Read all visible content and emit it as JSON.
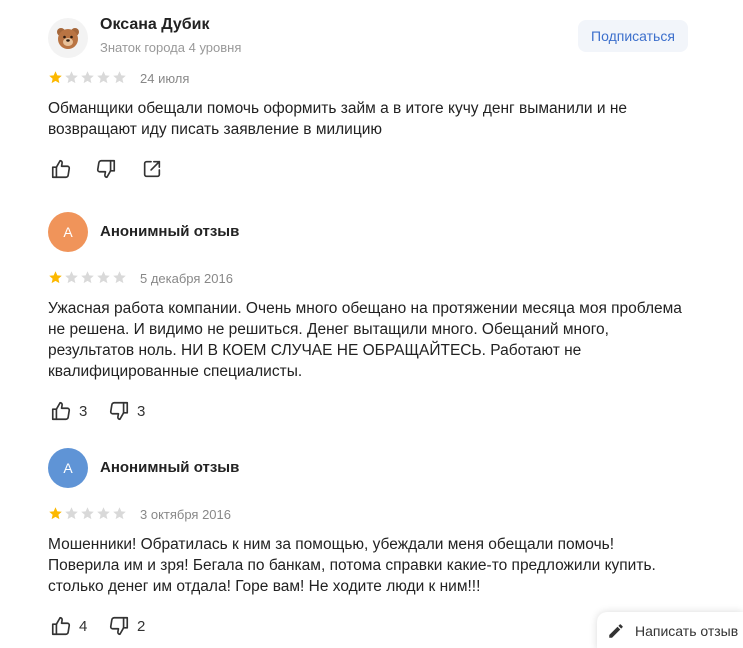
{
  "reviews": [
    {
      "author": "Оксана Дубик",
      "level": "Знаток города 4 уровня",
      "avatar_letter": "",
      "rating": 1,
      "date": "24 июля",
      "text": "Обманщики обещали помочь оформить займ а в итоге кучу денг выманили и не возвращают иду писать заявление в милицию",
      "likes": "",
      "dislikes": ""
    },
    {
      "author": "Анонимный отзыв",
      "avatar_letter": "А",
      "rating": 1,
      "date": "5 декабря 2016",
      "text": "Ужасная работа компании. Очень много обещано на протяжении месяца моя проблема не решена. И видимо не решиться. Денег вытащили много. Обещаний много, результатов ноль. НИ В КОЕМ СЛУЧАЕ НЕ ОБРАЩАЙТЕСЬ. Работают не квалифицированные специалисты.",
      "likes": "3",
      "dislikes": "3"
    },
    {
      "author": "Анонимный отзыв",
      "avatar_letter": "А",
      "rating": 1,
      "date": "3 октября 2016",
      "text": "Мошенники! Обратилась к ним за помощью, убеждали меня обещали помочь! Поверила им и зря! Бегала по банкам, потома справки какие-то предложили купить. столько денег им отдала! Горе вам! Не ходите люди к ним!!!",
      "likes": "4",
      "dislikes": "2"
    }
  ],
  "subscribe_label": "Подписаться",
  "write_review_label": "Написать отзыв",
  "colors": {
    "star_filled": "#fcb800",
    "star_empty": "#d9d9d9",
    "avatar_orange": "#f0945a",
    "avatar_blue": "#5f94d6",
    "subscribe_text": "#3c6fcc"
  }
}
